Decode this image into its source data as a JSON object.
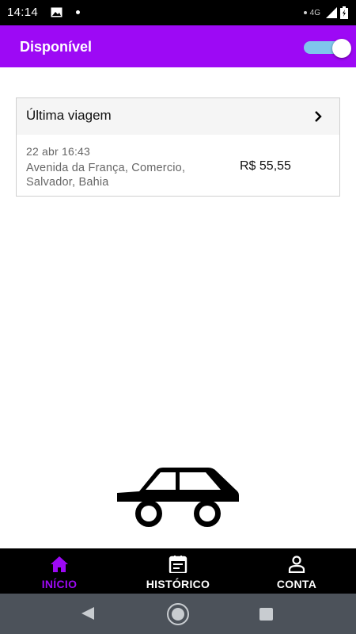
{
  "status_bar": {
    "time": "14:14",
    "network": "4G",
    "icons": [
      "image-icon",
      "notification-dot-icon",
      "signal-icon",
      "battery-icon"
    ]
  },
  "app_bar": {
    "title": "Disponível",
    "availability_toggle": {
      "on": true
    },
    "background": "#9d09f5"
  },
  "last_trip": {
    "title": "Última viagem",
    "date": "22 abr 16:43",
    "address": "Avenida da França, Comercio, Salvador, Bahia",
    "price": "R$ 55,55"
  },
  "bottom_nav": {
    "items": [
      {
        "label": "INÍCIO",
        "icon": "home-icon",
        "active": true
      },
      {
        "label": "HISTÓRICO",
        "icon": "calendar-icon",
        "active": false
      },
      {
        "label": "CONTA",
        "icon": "person-icon",
        "active": false
      }
    ],
    "active_color": "#9d09f5"
  },
  "system_nav": {
    "icons": [
      "back-icon",
      "home-circle-icon",
      "recents-icon"
    ]
  }
}
